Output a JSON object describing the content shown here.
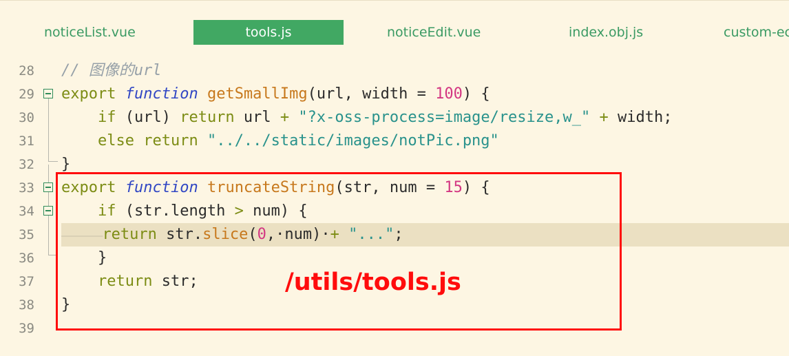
{
  "tabs": [
    {
      "label": "noticeList.vue",
      "active": false
    },
    {
      "label": "tools.js",
      "active": true
    },
    {
      "label": "noticeEdit.vue",
      "active": false
    },
    {
      "label": "index.obj.js",
      "active": false
    },
    {
      "label": "custom-ec",
      "active": false
    }
  ],
  "editor": {
    "current_line": 35,
    "lines": [
      {
        "num": "28"
      },
      {
        "num": "29"
      },
      {
        "num": "30"
      },
      {
        "num": "31"
      },
      {
        "num": "32"
      },
      {
        "num": "33"
      },
      {
        "num": "34"
      },
      {
        "num": "35"
      },
      {
        "num": "36"
      },
      {
        "num": "37"
      },
      {
        "num": "38"
      },
      {
        "num": "39"
      }
    ],
    "code": {
      "l28": {
        "comment": "// 图像的url"
      },
      "l29": {
        "kw_export": "export",
        "kw_function": "function",
        "name": "getSmallImg",
        "params_open": "(url, width = ",
        "default": "100",
        "params_close": ") {"
      },
      "l30": {
        "indent": "    ",
        "kw_if": "if",
        "cond": " (url) ",
        "kw_return": "return",
        "expr1": " url ",
        "op": "+",
        "space": " ",
        "str": "\"?x-oss-process=image/resize,w_\"",
        "space2": " ",
        "op2": "+",
        "tail": " width;"
      },
      "l31": {
        "indent": "    ",
        "kw_else": "else",
        "kw_return": "return",
        "str": "\"../../static/images/notPic.png\""
      },
      "l32": {
        "brace": "}"
      },
      "l33": {
        "kw_export": "export",
        "kw_function": "function",
        "name": "truncateString",
        "params_open": "(str, num = ",
        "default": "15",
        "params_close": ") {"
      },
      "l34": {
        "indent": "    ",
        "kw_if": "if",
        "cond_open": " (str.length ",
        "op": ">",
        "cond_close": " num) {"
      },
      "l35": {
        "ws1": "——————",
        "ws2": "——",
        "kw_return": "return",
        "expr": "str.",
        "method": "slice",
        "args_open": "(",
        "zero": "0",
        "args_mid": ",·num)·",
        "op": "+",
        "str": "\"...\"",
        "semi": ";"
      },
      "l36": {
        "indent": "    ",
        "brace": "}"
      },
      "l37": {
        "indent": "    ",
        "kw_return": "return",
        "tail": " str;"
      },
      "l38": {
        "brace": "}"
      }
    }
  },
  "annotation": {
    "text": "/utils/tools.js",
    "color": "#ff0c0c"
  },
  "colors": {
    "background": "#fdf6e3",
    "active_tab": "#41a863",
    "tab_text": "#3a9a63",
    "keyword": "#7c8c14",
    "function_name": "#c7781c",
    "function_keyword": "#3147c4",
    "string": "#29928c",
    "number": "#d33682",
    "comment": "#96a0a8",
    "current_line": "#ebe0c2"
  }
}
